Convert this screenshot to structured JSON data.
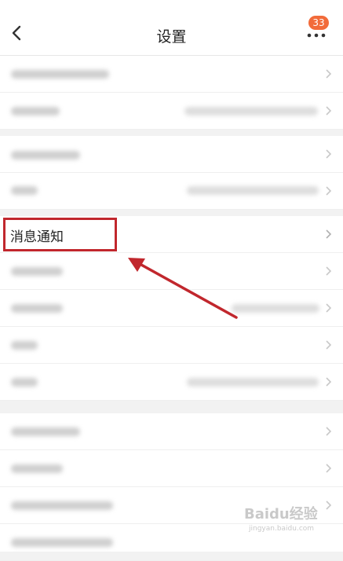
{
  "header": {
    "title": "设置",
    "back_icon": "chevron-left-icon",
    "more_icon": "more-dots-icon",
    "badge_count": "33",
    "badge_color": "#f26b3a"
  },
  "highlight": {
    "label": "消息通知",
    "box_color": "#c1272d",
    "arrow_color": "#c1272d"
  },
  "watermark": {
    "text": "Baidu经验",
    "sub": "jingyan.baidu.com"
  }
}
